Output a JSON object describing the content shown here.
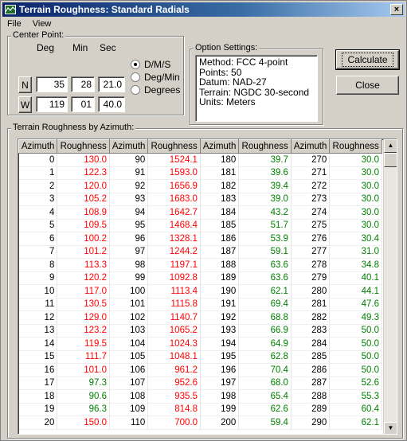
{
  "window": {
    "title": "Terrain Roughness: Standard Radials",
    "close_label": "×"
  },
  "menu": {
    "file": "File",
    "view": "View"
  },
  "center_point": {
    "label": "Center Point:",
    "headers": {
      "deg": "Deg",
      "min": "Min",
      "sec": "Sec"
    },
    "lat": {
      "hemisphere": "N",
      "deg": "35",
      "min": "28",
      "sec": "21.0"
    },
    "lon": {
      "hemisphere": "W",
      "deg": "119",
      "min": "01",
      "sec": "40.0"
    },
    "format_options": [
      {
        "label": "D/M/S",
        "selected": true
      },
      {
        "label": "Deg/Min",
        "selected": false
      },
      {
        "label": "Degrees",
        "selected": false
      }
    ]
  },
  "option_settings": {
    "label": "Option Settings:",
    "lines": [
      "Method: FCC 4-point",
      "Points: 50",
      "Datum: NAD-27",
      "Terrain: NGDC 30-second",
      "Units: Meters"
    ]
  },
  "buttons": {
    "calculate": "Calculate",
    "close": "Close"
  },
  "roughness": {
    "label": "Terrain Roughness by Azimuth:",
    "headers": [
      "Azimuth",
      "Roughness",
      "Azimuth",
      "Roughness",
      "Azimuth",
      "Roughness",
      "Azimuth",
      "Roughness"
    ],
    "colors": {
      "red": "#ff0000",
      "green": "#008000"
    },
    "rows": [
      [
        [
          "0",
          "130.0",
          "r"
        ],
        [
          "90",
          "1524.1",
          "r"
        ],
        [
          "180",
          "39.7",
          "g"
        ],
        [
          "270",
          "30.0",
          "g"
        ]
      ],
      [
        [
          "1",
          "122.3",
          "r"
        ],
        [
          "91",
          "1593.0",
          "r"
        ],
        [
          "181",
          "39.6",
          "g"
        ],
        [
          "271",
          "30.0",
          "g"
        ]
      ],
      [
        [
          "2",
          "120.0",
          "r"
        ],
        [
          "92",
          "1656.9",
          "r"
        ],
        [
          "182",
          "39.4",
          "g"
        ],
        [
          "272",
          "30.0",
          "g"
        ]
      ],
      [
        [
          "3",
          "105.2",
          "r"
        ],
        [
          "93",
          "1683.0",
          "r"
        ],
        [
          "183",
          "39.0",
          "g"
        ],
        [
          "273",
          "30.0",
          "g"
        ]
      ],
      [
        [
          "4",
          "108.9",
          "r"
        ],
        [
          "94",
          "1642.7",
          "r"
        ],
        [
          "184",
          "43.2",
          "g"
        ],
        [
          "274",
          "30.0",
          "g"
        ]
      ],
      [
        [
          "5",
          "109.5",
          "r"
        ],
        [
          "95",
          "1468.4",
          "r"
        ],
        [
          "185",
          "51.7",
          "g"
        ],
        [
          "275",
          "30.0",
          "g"
        ]
      ],
      [
        [
          "6",
          "100.2",
          "r"
        ],
        [
          "96",
          "1328.1",
          "r"
        ],
        [
          "186",
          "53.9",
          "g"
        ],
        [
          "276",
          "30.4",
          "g"
        ]
      ],
      [
        [
          "7",
          "101.2",
          "r"
        ],
        [
          "97",
          "1244.2",
          "r"
        ],
        [
          "187",
          "59.1",
          "g"
        ],
        [
          "277",
          "31.0",
          "g"
        ]
      ],
      [
        [
          "8",
          "113.3",
          "r"
        ],
        [
          "98",
          "1197.1",
          "r"
        ],
        [
          "188",
          "63.6",
          "g"
        ],
        [
          "278",
          "34.8",
          "g"
        ]
      ],
      [
        [
          "9",
          "120.2",
          "r"
        ],
        [
          "99",
          "1092.8",
          "r"
        ],
        [
          "189",
          "63.6",
          "g"
        ],
        [
          "279",
          "40.1",
          "g"
        ]
      ],
      [
        [
          "10",
          "117.0",
          "r"
        ],
        [
          "100",
          "1113.4",
          "r"
        ],
        [
          "190",
          "62.1",
          "g"
        ],
        [
          "280",
          "44.1",
          "g"
        ]
      ],
      [
        [
          "11",
          "130.5",
          "r"
        ],
        [
          "101",
          "1115.8",
          "r"
        ],
        [
          "191",
          "69.4",
          "g"
        ],
        [
          "281",
          "47.6",
          "g"
        ]
      ],
      [
        [
          "12",
          "129.0",
          "r"
        ],
        [
          "102",
          "1140.7",
          "r"
        ],
        [
          "192",
          "68.8",
          "g"
        ],
        [
          "282",
          "49.3",
          "g"
        ]
      ],
      [
        [
          "13",
          "123.2",
          "r"
        ],
        [
          "103",
          "1065.2",
          "r"
        ],
        [
          "193",
          "66.9",
          "g"
        ],
        [
          "283",
          "50.0",
          "g"
        ]
      ],
      [
        [
          "14",
          "119.5",
          "r"
        ],
        [
          "104",
          "1024.3",
          "r"
        ],
        [
          "194",
          "64.9",
          "g"
        ],
        [
          "284",
          "50.0",
          "g"
        ]
      ],
      [
        [
          "15",
          "111.7",
          "r"
        ],
        [
          "105",
          "1048.1",
          "r"
        ],
        [
          "195",
          "62.8",
          "g"
        ],
        [
          "285",
          "50.0",
          "g"
        ]
      ],
      [
        [
          "16",
          "101.0",
          "r"
        ],
        [
          "106",
          "961.2",
          "r"
        ],
        [
          "196",
          "70.4",
          "g"
        ],
        [
          "286",
          "50.0",
          "g"
        ]
      ],
      [
        [
          "17",
          "97.3",
          "g"
        ],
        [
          "107",
          "952.6",
          "r"
        ],
        [
          "197",
          "68.0",
          "g"
        ],
        [
          "287",
          "52.6",
          "g"
        ]
      ],
      [
        [
          "18",
          "90.6",
          "g"
        ],
        [
          "108",
          "935.5",
          "r"
        ],
        [
          "198",
          "65.4",
          "g"
        ],
        [
          "288",
          "55.3",
          "g"
        ]
      ],
      [
        [
          "19",
          "96.3",
          "g"
        ],
        [
          "109",
          "814.8",
          "r"
        ],
        [
          "199",
          "62.6",
          "g"
        ],
        [
          "289",
          "60.4",
          "g"
        ]
      ],
      [
        [
          "20",
          "150.0",
          "r"
        ],
        [
          "110",
          "700.0",
          "r"
        ],
        [
          "200",
          "59.4",
          "g"
        ],
        [
          "290",
          "62.1",
          "g"
        ]
      ]
    ]
  }
}
